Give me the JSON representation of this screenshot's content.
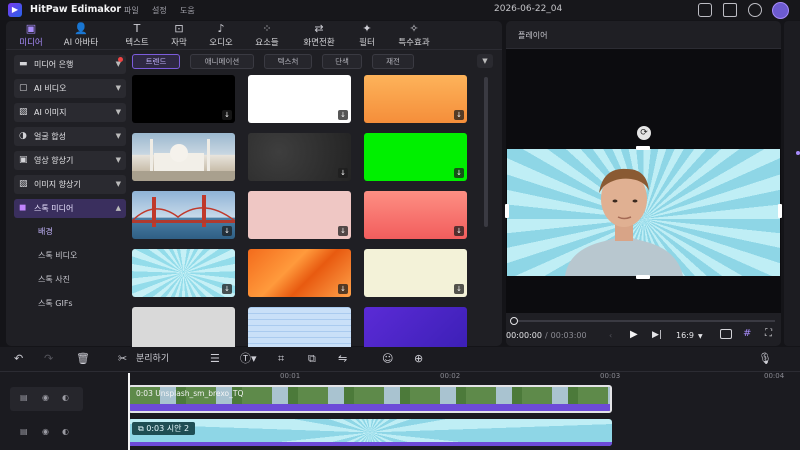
{
  "app": {
    "name": "HitPaw Edimakor",
    "menu": [
      "파일",
      "설정",
      "도움"
    ],
    "project_title": "2026-06-22_04"
  },
  "media_tabs": [
    {
      "label": "미디어",
      "icon": "media-icon",
      "active": true
    },
    {
      "label": "AI 아바타",
      "icon": "ai-avatar-icon"
    },
    {
      "label": "텍스트",
      "icon": "text-icon"
    },
    {
      "label": "자막",
      "icon": "subtitle-icon"
    },
    {
      "label": "오디오",
      "icon": "music-icon"
    },
    {
      "label": "요소들",
      "icon": "elements-icon"
    },
    {
      "label": "화면전환",
      "icon": "transition-icon"
    },
    {
      "label": "필터",
      "icon": "filter-icon"
    },
    {
      "label": "특수효과",
      "icon": "effects-icon"
    }
  ],
  "sidebar": {
    "items": [
      {
        "label": "미디어 은행",
        "icon": "folder-icon",
        "badge": true
      },
      {
        "label": "AI 비디오",
        "icon": "ai-video-icon"
      },
      {
        "label": "AI 이미지",
        "icon": "ai-image-icon"
      },
      {
        "label": "얼굴 합성",
        "icon": "face-swap-icon"
      },
      {
        "label": "영상 향상기",
        "icon": "video-enhance-icon"
      },
      {
        "label": "이미지 향상기",
        "icon": "image-enhance-icon"
      },
      {
        "label": "스톡 미디어",
        "icon": "stock-media-icon",
        "active": true
      }
    ],
    "subitems": [
      {
        "label": "배경",
        "active": true
      },
      {
        "label": "스톡 비디오"
      },
      {
        "label": "스톡 사진"
      },
      {
        "label": "스톡 GIFs"
      }
    ]
  },
  "filters": {
    "chips": [
      "트렌드",
      "애니메이션",
      "텍스처",
      "단색",
      "재전"
    ],
    "active": "트렌드"
  },
  "player": {
    "label": "플레이어",
    "current_time": "00:00:00",
    "total_time": "00:03:00",
    "time_separator": "/",
    "aspect_ratio": "16:9"
  },
  "timeline": {
    "split_label": "분리하기",
    "ruler": [
      "00:01",
      "00:02",
      "00:03",
      "00:04"
    ],
    "clips": [
      {
        "label": "0:03 Unsplash_sm_brexo_TQ",
        "icon": "video-icon"
      },
      {
        "label": "0:03 시안 2",
        "icon": "image-icon"
      }
    ]
  },
  "colors": {
    "accent": "#a78bfa",
    "background": "#141418",
    "panel": "#1f1f24",
    "track_purple": "#6d4bd8"
  }
}
